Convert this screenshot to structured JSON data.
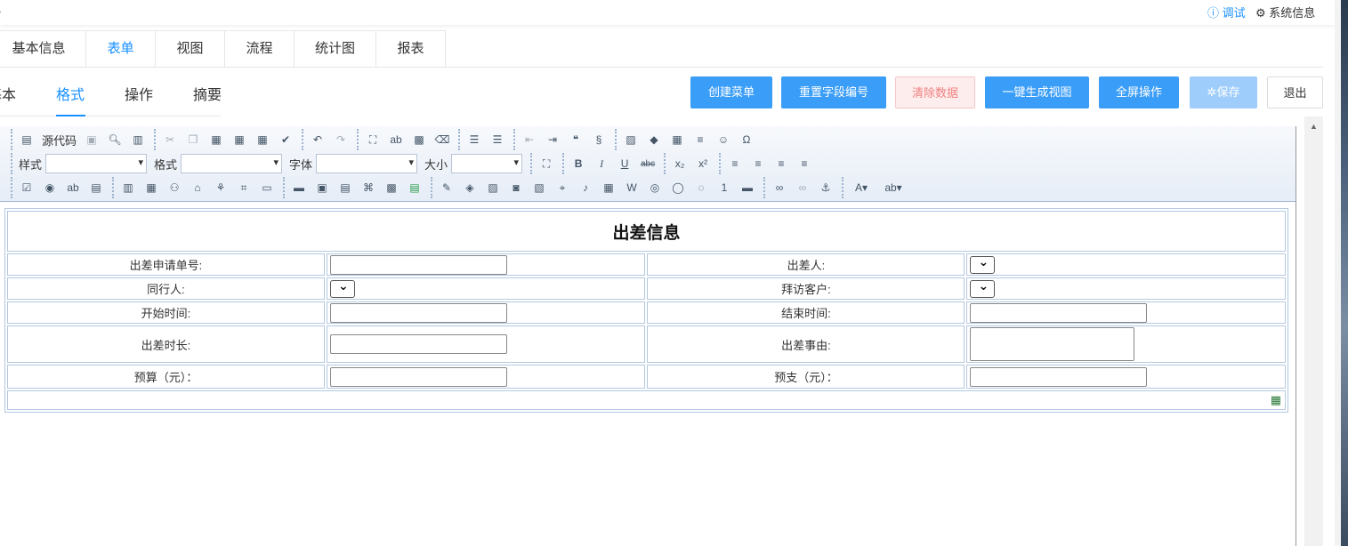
{
  "topbar": {
    "back": "›",
    "debug": "ⓘ 调试",
    "sysinfo": "⚙ 系统信息"
  },
  "main_tabs": [
    {
      "label": "基本信息"
    },
    {
      "label": "表单",
      "active": true
    },
    {
      "label": "视图"
    },
    {
      "label": "流程"
    },
    {
      "label": "统计图"
    },
    {
      "label": "报表"
    }
  ],
  "sub_tabs": [
    {
      "label": "基本"
    },
    {
      "label": "格式",
      "active": true
    },
    {
      "label": "操作"
    },
    {
      "label": "摘要"
    }
  ],
  "actions": {
    "create_menu": "创建菜单",
    "reset_field_numbers": "重置字段编号",
    "clear_data": "清除数据",
    "generate_view": "一键生成视图",
    "fullscreen": "全屏操作",
    "save": "✲保存",
    "exit": "退出"
  },
  "toolbar": {
    "source_code": "源代码",
    "style_label": "样式",
    "format_label": "格式",
    "font_label": "字体",
    "size_label": "大小",
    "style_value": "",
    "format_value": "",
    "font_value": "",
    "size_value": ""
  },
  "form": {
    "title": "出差信息",
    "fields": {
      "application_no": "出差申请单号:",
      "traveler": "出差人:",
      "companions": "同行人:",
      "visited_customer": "拜访客户:",
      "start_time": "开始时间:",
      "end_time": "结束时间:",
      "duration": "出差时长:",
      "reason": "出差事由:",
      "budget": "预算（元）：",
      "advance": "预支（元）："
    }
  },
  "colors": {
    "accent": "#1890ff",
    "button": "#3a9df7",
    "danger_text": "#f08080",
    "disabled": "#9fcdfb"
  }
}
